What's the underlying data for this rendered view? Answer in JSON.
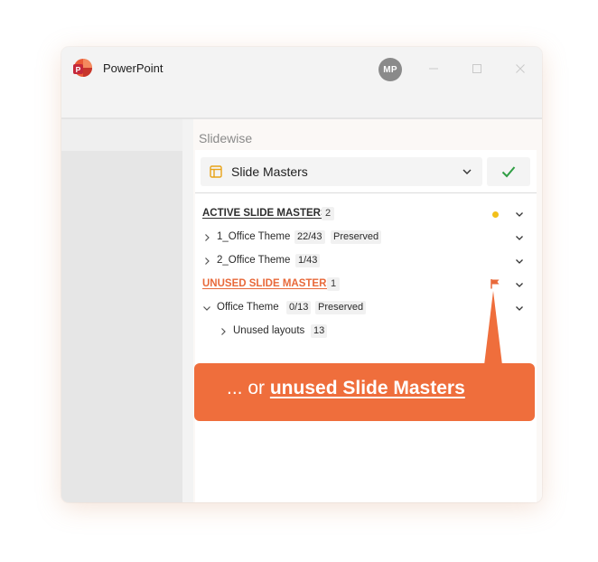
{
  "app": {
    "name": "PowerPoint",
    "avatar_initials": "MP"
  },
  "addin": {
    "title": "Slidewise",
    "selector": {
      "label": "Slide Masters",
      "icon": "layout-icon"
    },
    "confirm_icon": "checkmark-icon"
  },
  "sections": {
    "active": {
      "title": "ACTIVE SLIDE MASTERS",
      "count": "2",
      "status_color": "#f2c01a",
      "items": [
        {
          "name": "1_Office Theme",
          "usage": "22/43",
          "tag": "Preserved"
        },
        {
          "name": "2_Office Theme",
          "usage": "1/43",
          "tag": ""
        }
      ]
    },
    "unused": {
      "title": "UNUSED SLIDE MASTERS",
      "count": "1",
      "accent_color": "#e8693a",
      "items": [
        {
          "name": "Office Theme",
          "usage": "0/13",
          "tag": "Preserved",
          "children": [
            {
              "name": "Unused layouts",
              "count": "13"
            }
          ]
        }
      ]
    }
  },
  "callout": {
    "prefix": "... or ",
    "emphasis": "unused Slide Masters",
    "color": "#ef6e3c"
  }
}
